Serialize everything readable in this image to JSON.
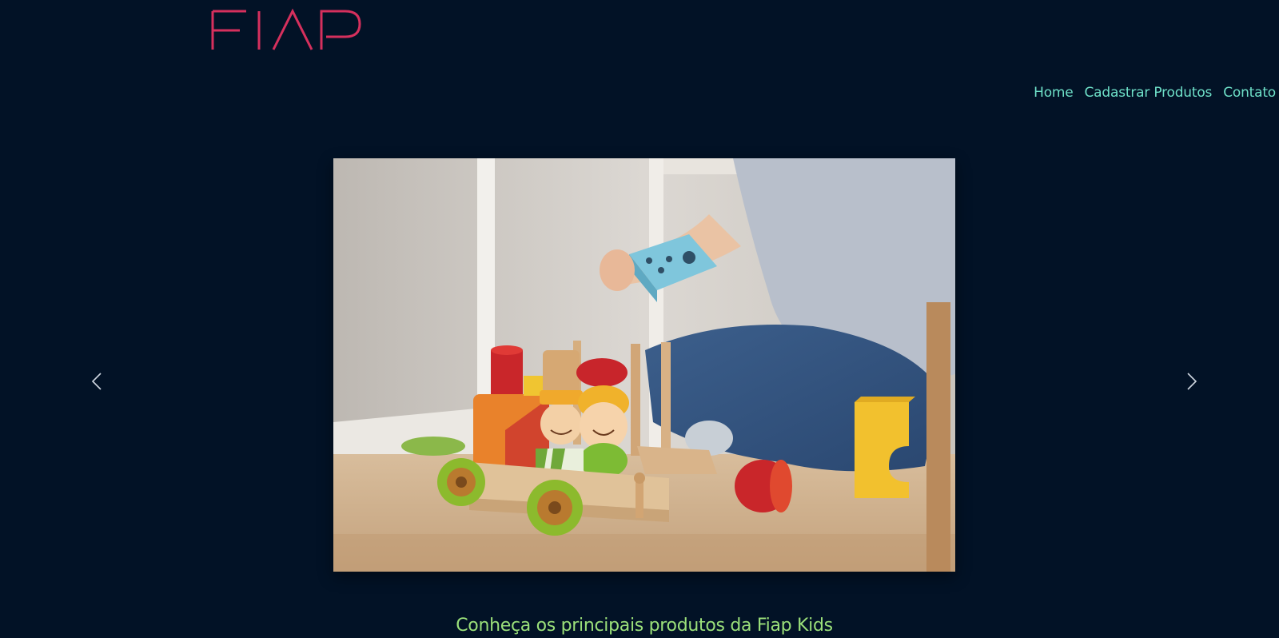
{
  "brand": {
    "logo_text": "FIAP",
    "logo_color": "#d6305d"
  },
  "nav": {
    "items": [
      {
        "label": "Home"
      },
      {
        "label": "Cadastrar Produtos"
      },
      {
        "label": "Contato"
      }
    ],
    "link_color": "#6ee0c8"
  },
  "carousel": {
    "prev_icon": "chevron-left-icon",
    "next_icon": "chevron-right-icon"
  },
  "main": {
    "headline": "Conheça os principais produtos da Fiap Kids",
    "headline_color": "#9be07a"
  },
  "colors": {
    "background": "#021226"
  }
}
